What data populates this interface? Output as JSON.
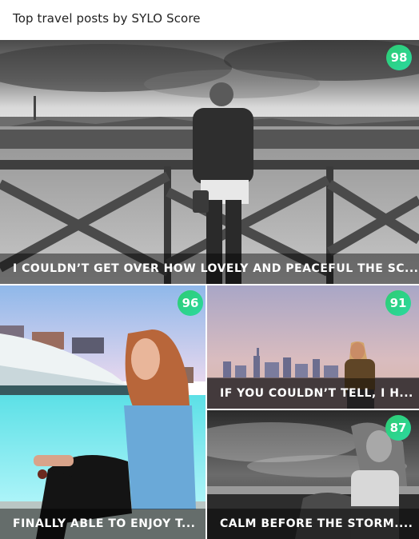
{
  "header": {
    "title": "Top travel posts by SYLO Score"
  },
  "badge_color": "#2ecc71",
  "posts": [
    {
      "score": "98",
      "caption": "I COULDN’T GET OVER HOW LOVELY AND PEACEFUL THE SC..."
    },
    {
      "score": "96",
      "caption": "FINALLY ABLE TO ENJOY T..."
    },
    {
      "score": "91",
      "caption": "IF YOU COULDN’T TELL, I H..."
    },
    {
      "score": "87",
      "caption": "CALM BEFORE THE STORM...."
    }
  ]
}
